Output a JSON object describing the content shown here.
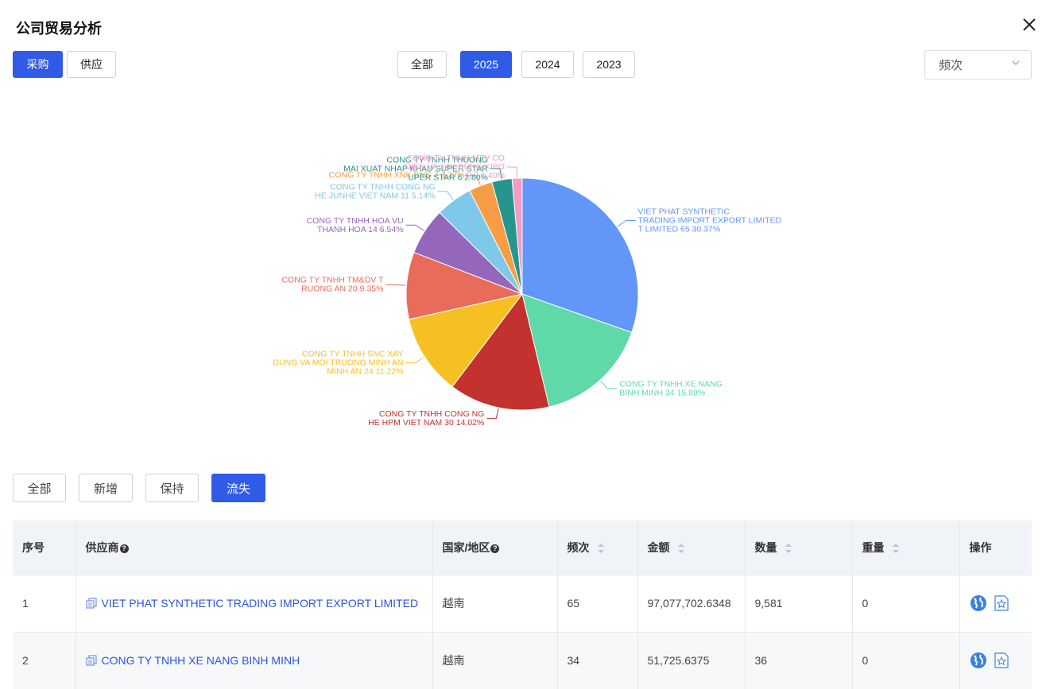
{
  "title": "公司贸易分析",
  "trade_tabs": [
    "采购",
    "供应"
  ],
  "year_tabs": [
    "全部",
    "2025",
    "2024",
    "2023"
  ],
  "sort_select": "频次",
  "filter_tabs": [
    "全部",
    "新增",
    "保持",
    "流失"
  ],
  "colors": {
    "accent": "#2f5be6",
    "link": "#2c56d6",
    "header_bg": "#f0f3f7"
  },
  "chart_data": {
    "type": "pie",
    "slices": [
      {
        "label": [
          "VIET PHAT SYNTHETIC",
          "TRADING IMPORT EXPORT LIMITED",
          "T LIMITED 65 30.37%"
        ],
        "value": 30.37,
        "color": "#6296f9"
      },
      {
        "label": [
          "CONG TY TNHH XE NANG",
          "BINH MINH 34 15.89%"
        ],
        "value": 15.89,
        "color": "#5fd9a8"
      },
      {
        "label": [
          "CONG TY TNHH CONG NG",
          "HE HPM VIET NAM 30 14.02%"
        ],
        "value": 14.02,
        "color": "#c3322e"
      },
      {
        "label": [
          "CONG TY TNHH SNC XAY",
          "DUNG VA MOI TRUONG MINH AN",
          "MINH AN 24 11.22%"
        ],
        "value": 11.22,
        "color": "#f6c022"
      },
      {
        "label": [
          "CONG TY TNHH TM&DV T",
          "RUONG AN 20 9.35%"
        ],
        "value": 9.35,
        "color": "#e96b59"
      },
      {
        "label": [
          "CONG TY TNHH HOA VU",
          "THANH HOA 14 6.54%"
        ],
        "value": 6.54,
        "color": "#9467bd"
      },
      {
        "label": [
          "CONG TY TNHH CONG NG",
          "HE JUNHE VIET NAM 11 5.14%"
        ],
        "value": 5.14,
        "color": "#7ec8ea"
      },
      {
        "label": [
          "CONG TY TNHH XNK BNG  7  3.27%"
        ],
        "value": 3.27,
        "color": "#f79d45"
      },
      {
        "label": [
          "CONG TY TNHH THUONG",
          "MAI XUAT NHAP KHAU SUPER STAR",
          "UPER STAR 6 2.80%"
        ],
        "value": 2.8,
        "color": "#26958e"
      },
      {
        "label": [
          "CONG TY TNHH MTV CO",
          "DIEN VA XAY DUNG KIPO",
          "O 3 1.40%"
        ],
        "value": 1.4,
        "color": "#f59bc6"
      }
    ]
  },
  "table": {
    "headers": [
      "序号",
      "供应商",
      "国家/地区",
      "频次",
      "金额",
      "数量",
      "重量",
      "操作"
    ],
    "rows": [
      {
        "index": "1",
        "supplier": "VIET PHAT SYNTHETIC TRADING IMPORT EXPORT LIMITED",
        "country": "越南",
        "freq": "65",
        "amount": "97,077,702.6348",
        "qty": "9,581",
        "weight": "0"
      },
      {
        "index": "2",
        "supplier": "CONG TY TNHH XE NANG BINH MINH",
        "country": "越南",
        "freq": "34",
        "amount": "51,725.6375",
        "qty": "36",
        "weight": "0"
      }
    ]
  }
}
